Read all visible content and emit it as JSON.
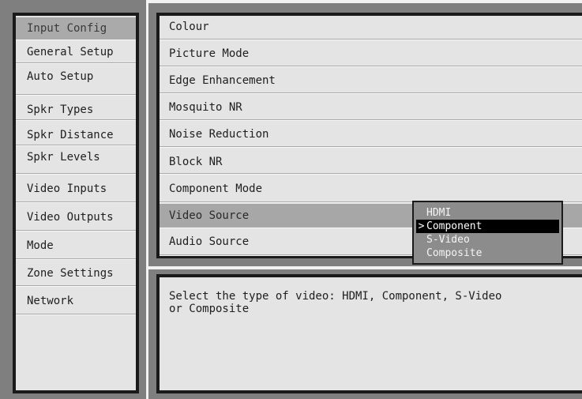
{
  "sidebar": {
    "items": [
      {
        "label": "Input Config"
      },
      {
        "label": "General Setup"
      },
      {
        "label": "Auto Setup"
      },
      {
        "label": "Spkr Types"
      },
      {
        "label": "Spkr Distance"
      },
      {
        "label": "Spkr Levels"
      },
      {
        "label": "Video Inputs"
      },
      {
        "label": "Video Outputs"
      },
      {
        "label": "Mode"
      },
      {
        "label": "Zone Settings"
      },
      {
        "label": "Network"
      }
    ],
    "selected": "Input Config"
  },
  "settings": {
    "items": [
      {
        "label": "Colour"
      },
      {
        "label": "Picture Mode"
      },
      {
        "label": "Edge Enhancement"
      },
      {
        "label": "Mosquito NR"
      },
      {
        "label": "Noise Reduction"
      },
      {
        "label": "Block NR"
      },
      {
        "label": "Component Mode"
      },
      {
        "label": "Video Source"
      },
      {
        "label": "Audio Source"
      }
    ],
    "highlighted": "Video Source"
  },
  "dropdown": {
    "marker": ">",
    "options": [
      "HDMI",
      "Component",
      "S-Video",
      "Composite"
    ],
    "selected": "Component"
  },
  "help": {
    "text": "Select the type of video: HDMI, Component, S-Video\nor Composite"
  },
  "colors": {
    "background": "#7f7f7f",
    "panel": "#e4e4e4",
    "highlight": "#a7a7a7",
    "dropdown": "#8c8c8c",
    "dropdown_selected": "#000000"
  }
}
